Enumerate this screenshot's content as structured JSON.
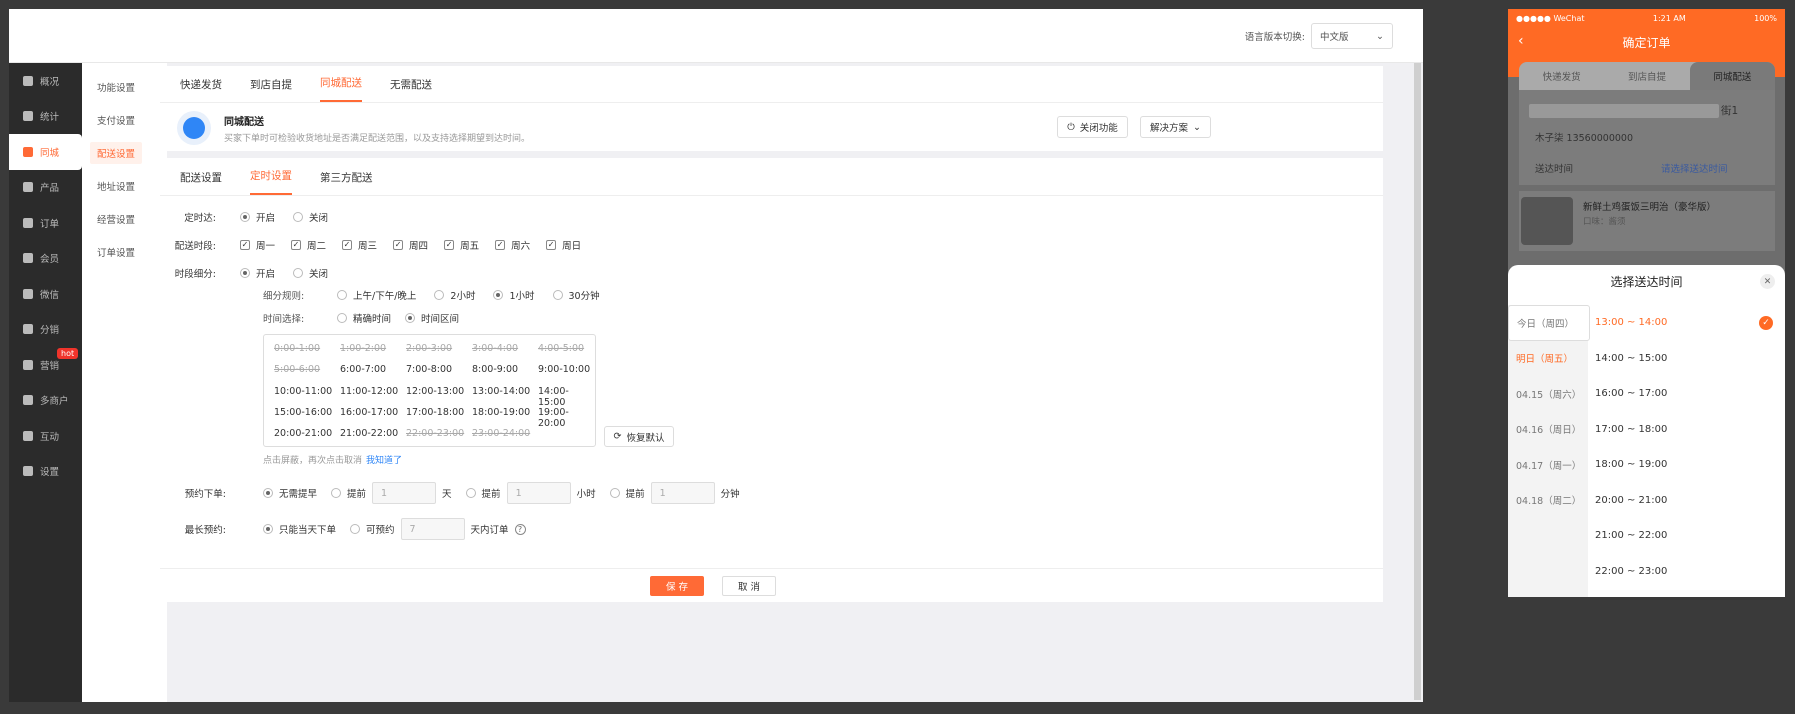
{
  "topbar": {
    "lang_label": "语言版本切换:",
    "lang_value": "中文版"
  },
  "nav1": [
    {
      "label": "概况",
      "icon": "layers-icon"
    },
    {
      "label": "统计",
      "icon": "chart-icon"
    },
    {
      "label": "同城",
      "icon": "city-icon",
      "active": true
    },
    {
      "label": "产品",
      "icon": "grid-icon"
    },
    {
      "label": "订单",
      "icon": "order-icon"
    },
    {
      "label": "会员",
      "icon": "crown-icon"
    },
    {
      "label": "微信",
      "icon": "wechat-icon"
    },
    {
      "label": "分销",
      "icon": "share-icon"
    },
    {
      "label": "营销",
      "icon": "flag-icon",
      "badge": "hot"
    },
    {
      "label": "多商户",
      "icon": "store-icon"
    },
    {
      "label": "互动",
      "icon": "interact-icon"
    },
    {
      "label": "设置",
      "icon": "gear-icon"
    }
  ],
  "nav2": [
    "功能设置",
    "支付设置",
    "配送设置",
    "地址设置",
    "经营设置",
    "订单设置"
  ],
  "card1": {
    "tabs": [
      "快递发货",
      "到店自提",
      "同城配送",
      "无需配送"
    ],
    "feature_title": "同城配送",
    "feature_desc": "买家下单时可检验收货地址是否满足配送范围，以及支持选择期望到达时间。",
    "close_btn": "关闭功能",
    "solution_btn": "解决方案"
  },
  "card2": {
    "tabs": [
      "配送设置",
      "定时设置",
      "第三方配送"
    ],
    "timed_label": "定时达:",
    "on": "开启",
    "off": "关闭",
    "period_label": "配送时段:",
    "weekdays": [
      "周一",
      "周二",
      "周三",
      "周四",
      "周五",
      "周六",
      "周日"
    ],
    "split_label": "时段细分:",
    "rule_label": "细分规则:",
    "rules": [
      "上午/下午/晚上",
      "2小时",
      "1小时",
      "30分钟"
    ],
    "select_label": "时间选择:",
    "selects": [
      "精确时间",
      "时间区间"
    ],
    "slots": [
      [
        "0:00-1:00",
        "1:00-2:00",
        "2:00-3:00",
        "3:00-4:00",
        "4:00-5:00"
      ],
      [
        "5:00-6:00",
        "6:00-7:00",
        "7:00-8:00",
        "8:00-9:00",
        "9:00-10:00"
      ],
      [
        "10:00-11:00",
        "11:00-12:00",
        "12:00-13:00",
        "13:00-14:00",
        "14:00-15:00"
      ],
      [
        "15:00-16:00",
        "16:00-17:00",
        "17:00-18:00",
        "18:00-19:00",
        "19:00-20:00"
      ],
      [
        "20:00-21:00",
        "21:00-22:00",
        "22:00-23:00",
        "23:00-24:00"
      ]
    ],
    "disabled_slots": [
      "0:00-1:00",
      "1:00-2:00",
      "2:00-3:00",
      "3:00-4:00",
      "4:00-5:00",
      "5:00-6:00",
      "22:00-23:00",
      "23:00-24:00"
    ],
    "restore_btn": "恢复默认",
    "hint": "点击屏蔽，再次点击取消",
    "hint_link": "我知道了",
    "preorder_label": "预约下单:",
    "no_advance": "无需提早",
    "advance": "提前",
    "advance_value": "1",
    "unit_day": "天",
    "unit_hour": "小时",
    "unit_min": "分钟",
    "max_label": "最长预约:",
    "only_today": "只能当天下单",
    "can_book": "可预约",
    "book_value": "7",
    "book_unit": "天内订单"
  },
  "footer": {
    "save": "保 存",
    "cancel": "取 消"
  },
  "phone": {
    "carrier": "●●●●● WeChat",
    "time": "1:21 AM",
    "battery": "100%",
    "title": "确定订单",
    "tabs": [
      "快递发货",
      "到店自提",
      "同城配送"
    ],
    "addr_tail": "街1",
    "contact": "木子柒  13560000000",
    "time_label": "送达时间",
    "time_hint": "请选择送达时间",
    "goods": "新鲜土鸡蛋饭三明治（豪华版）",
    "goods_spec": "口味：酱须",
    "sheet_title": "选择送达时间",
    "days": [
      "今日（周四）",
      "明日（周五）",
      "04.15（周六）",
      "04.16（周日）",
      "04.17（周一）",
      "04.18（周二）"
    ],
    "times": [
      "13:00 ~ 14:00",
      "14:00 ~ 15:00",
      "16:00 ~ 17:00",
      "17:00 ~ 18:00",
      "18:00 ~ 19:00",
      "20:00 ~ 21:00",
      "21:00 ~ 22:00",
      "22:00 ~ 23:00"
    ]
  },
  "colors": {
    "accent": "#ff6a36",
    "sidebar": "#2b2b2b",
    "link": "#2f86f6"
  }
}
